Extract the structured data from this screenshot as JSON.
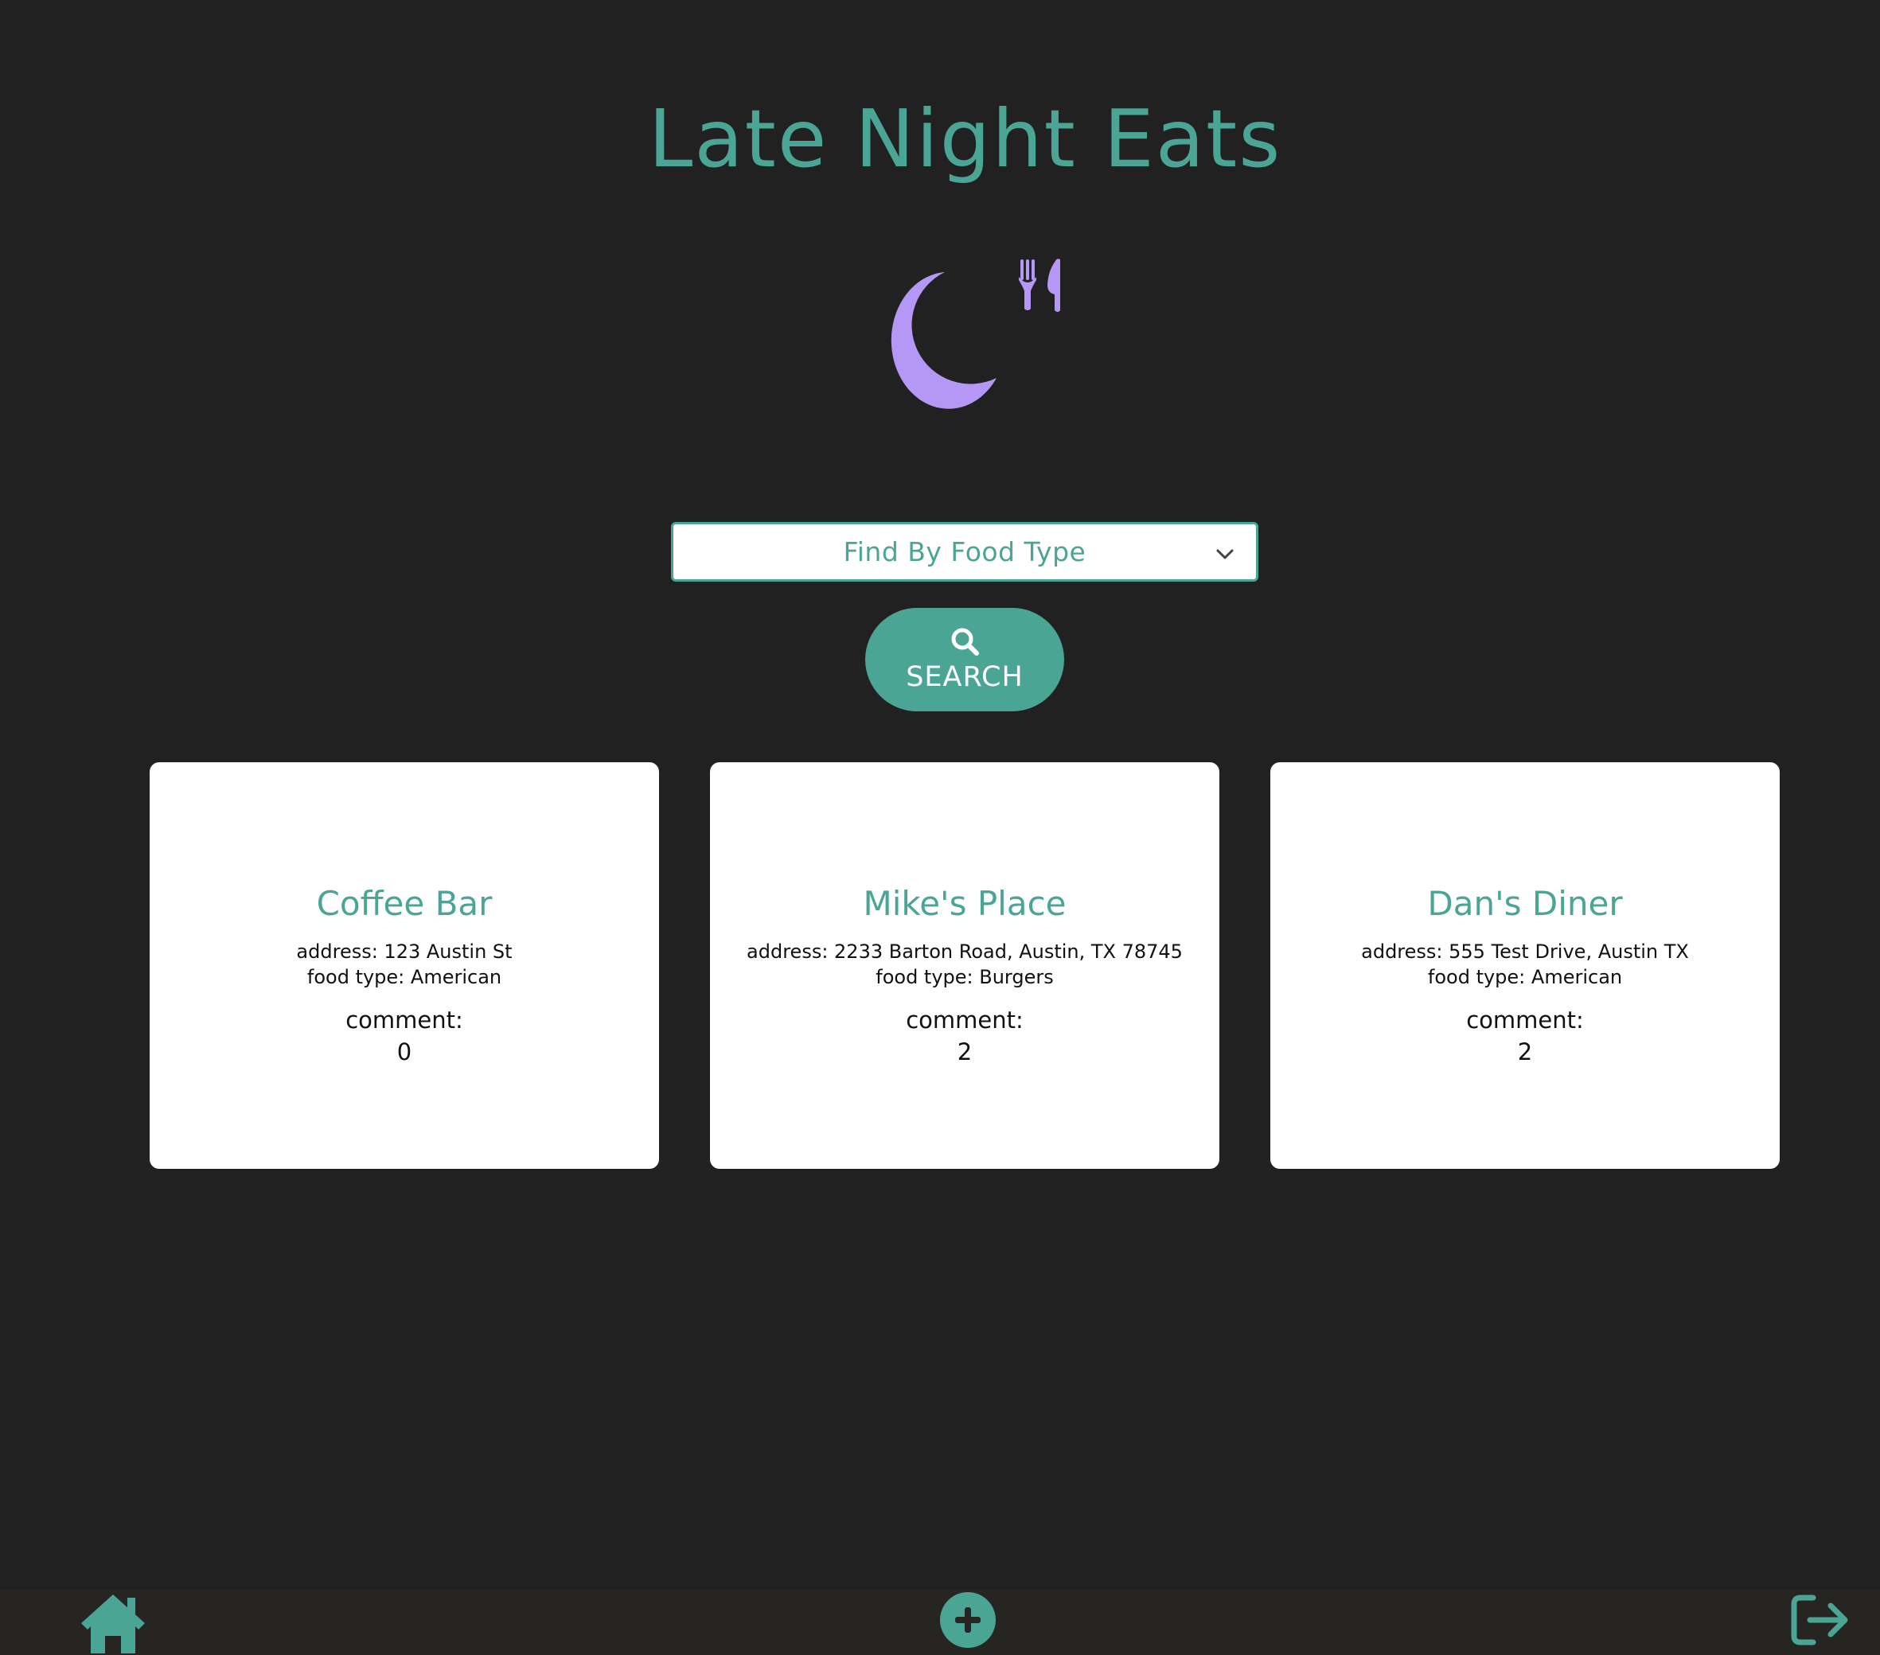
{
  "header": {
    "title": "Late Night Eats",
    "logo_icon": "moon-with-utensils-icon"
  },
  "filter": {
    "selected": "Find By Food Type",
    "chevron_icon": "chevron-down-icon"
  },
  "search": {
    "label": "SEARCH",
    "icon": "search-icon"
  },
  "restaurants": [
    {
      "name": "Coffee Bar",
      "address": "address: 123 Austin St",
      "food_type": "food type: American",
      "comment_label": "comment:",
      "comment_count": "0"
    },
    {
      "name": "Mike's Place",
      "address": "address: 2233 Barton Road, Austin, TX 78745",
      "food_type": "food type: Burgers",
      "comment_label": "comment:",
      "comment_count": "2"
    },
    {
      "name": "Dan's Diner",
      "address": "address: 555 Test Drive, Austin TX",
      "food_type": "food type: American",
      "comment_label": "comment:",
      "comment_count": "2"
    }
  ],
  "footer": {
    "home_icon": "home-icon",
    "add_icon": "plus-circle-icon",
    "logout_icon": "logout-icon"
  },
  "colors": {
    "background": "#212121",
    "accent": "#4aa595",
    "logo": "#b598f5",
    "card": "#ffffff",
    "footer": "#262522"
  }
}
